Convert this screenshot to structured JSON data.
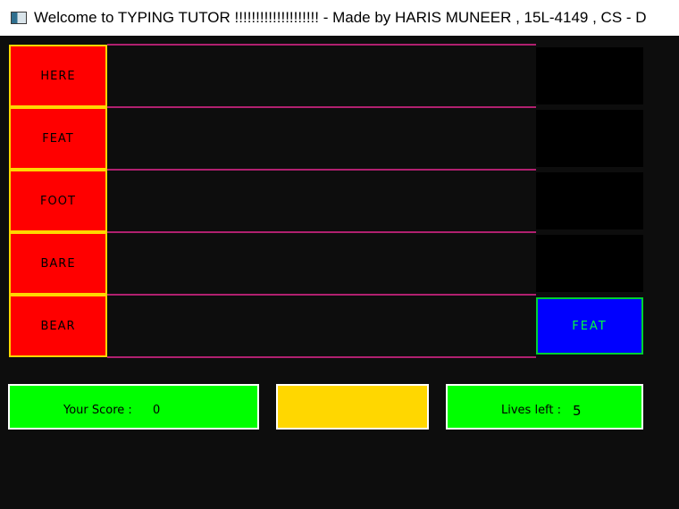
{
  "window": {
    "title": "Welcome to TYPING TUTOR !!!!!!!!!!!!!!!!!!!!  -  Made by HARIS MUNEER , 15L-4149 , CS - D"
  },
  "colors": {
    "background": "#0d0d0d",
    "word_box": "#ff0000",
    "word_box_border": "#ffd700",
    "lane_line": "#b0206f",
    "target_active": "#0000ff",
    "target_text": "#00ff40",
    "panel_green": "#00ff00",
    "panel_yellow": "#ffd700"
  },
  "lanes": [
    {
      "word": "HERE"
    },
    {
      "word": "FEAT"
    },
    {
      "word": "FOOT"
    },
    {
      "word": "BARE"
    },
    {
      "word": "BEAR"
    }
  ],
  "target": {
    "active_lane": 5,
    "word": "FEAT"
  },
  "score": {
    "label": "Your Score :",
    "value": "0"
  },
  "lives": {
    "label": "Lives left :",
    "value": "5"
  }
}
